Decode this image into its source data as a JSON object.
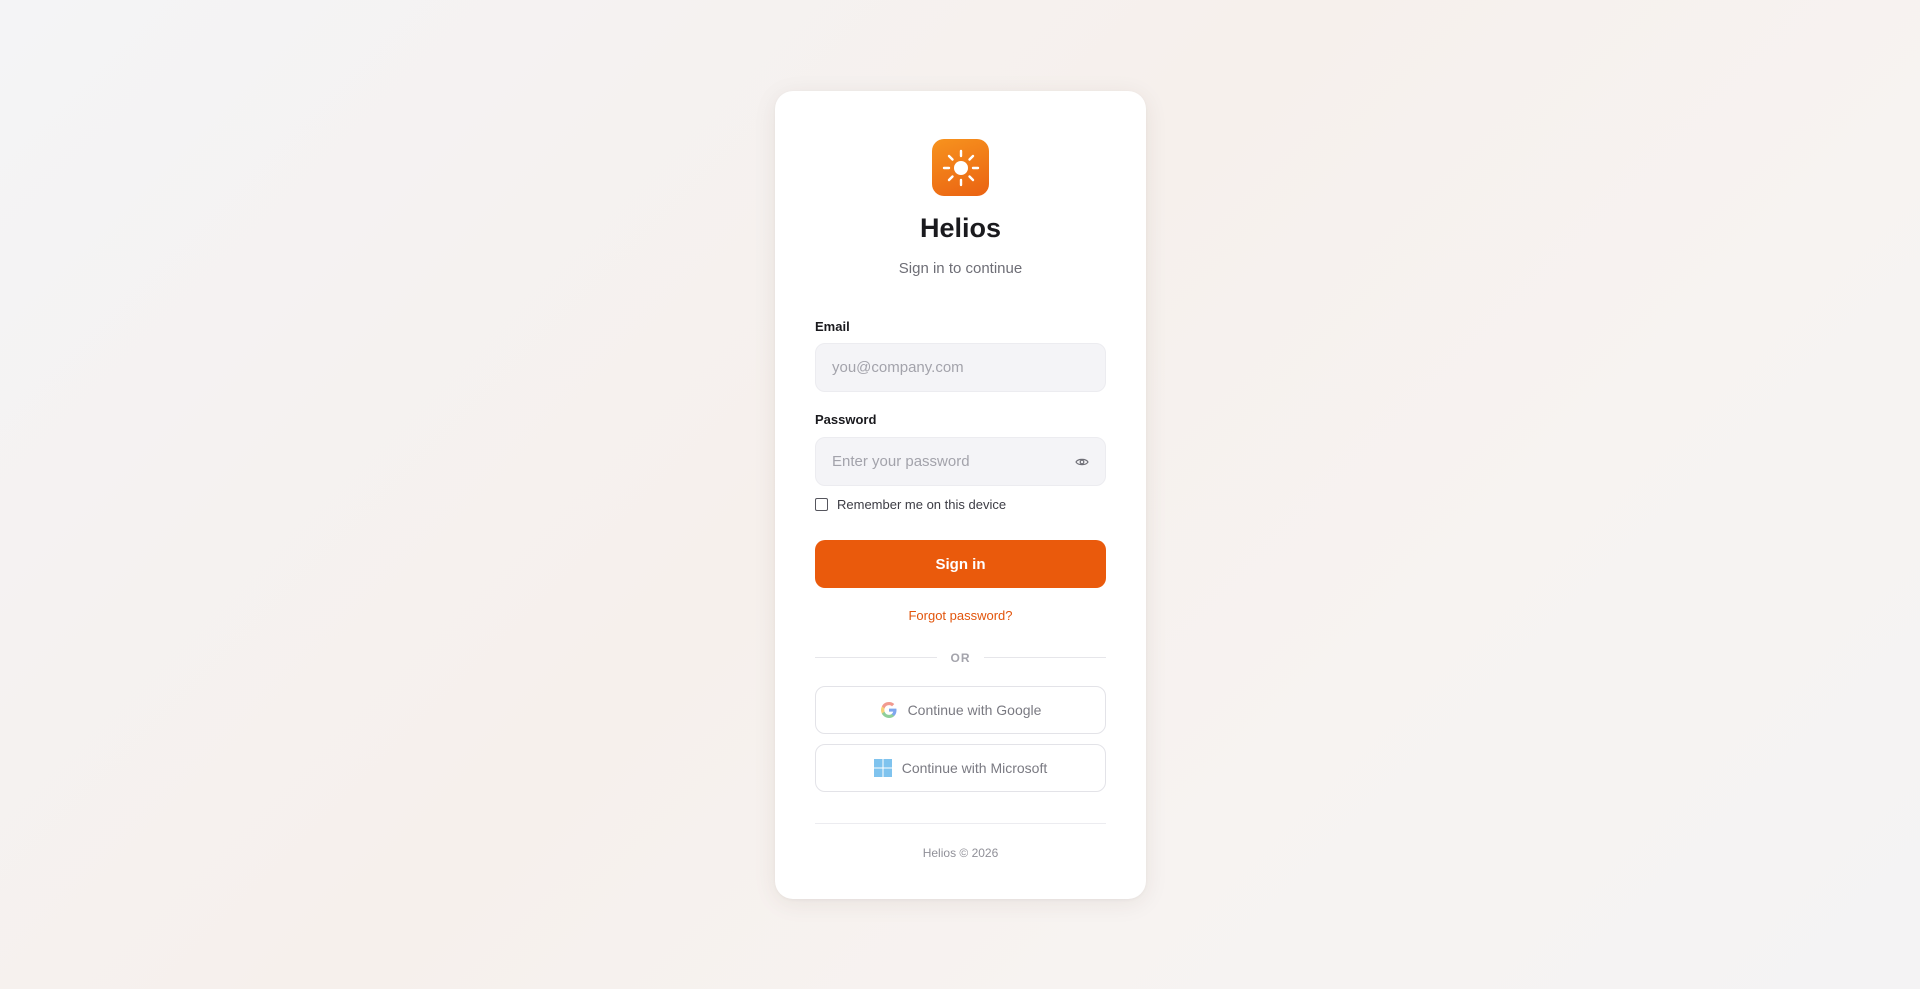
{
  "brand": {
    "name": "Helios",
    "subtitle": "Sign in to continue",
    "logo_icon": "sun-icon",
    "accent_color": "#ea5a0c"
  },
  "form": {
    "email": {
      "label": "Email",
      "placeholder": "you@company.com",
      "value": ""
    },
    "password": {
      "label": "Password",
      "placeholder": "Enter your password",
      "value": "",
      "toggle_icon": "eye-icon"
    },
    "remember": {
      "label": "Remember me on this device",
      "checked": false
    },
    "submit_label": "Sign in",
    "forgot_label": "Forgot password?"
  },
  "divider_label": "OR",
  "social": [
    {
      "label": "Continue with Google",
      "icon": "google-icon"
    },
    {
      "label": "Continue with Microsoft",
      "icon": "microsoft-icon"
    }
  ],
  "footer": {
    "text": "Helios © 2026"
  }
}
